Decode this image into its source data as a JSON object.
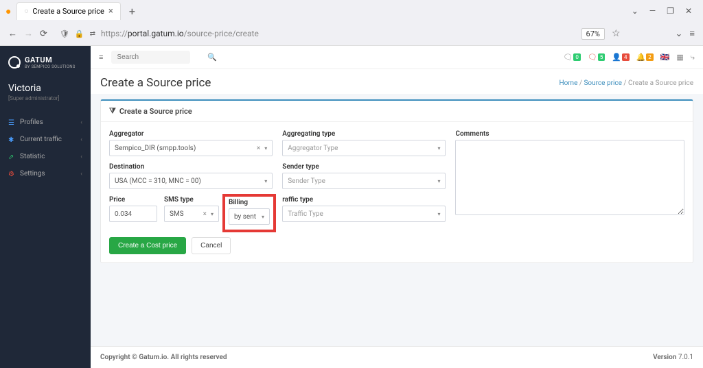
{
  "browser": {
    "tab_title": "Create a Source price",
    "url_prefix": "https://",
    "url_host": "portal.gatum.io",
    "url_path": "/source-price/create",
    "zoom": "67%"
  },
  "brand": {
    "name": "GATUM",
    "tagline": "BY SEMPICO SOLUTIONS"
  },
  "user": {
    "name": "Victoria",
    "role": "[Super administrator]"
  },
  "sidebar": {
    "items": [
      {
        "label": "Profiles"
      },
      {
        "label": "Current traffic"
      },
      {
        "label": "Statistic"
      },
      {
        "label": "Settings"
      }
    ]
  },
  "topbar": {
    "search_placeholder": "Search",
    "badges": [
      "0",
      "5",
      "4",
      "2"
    ]
  },
  "page": {
    "title": "Create a Source price",
    "breadcrumb": {
      "home": "Home",
      "parent": "Source price",
      "current": "Create a Source price"
    },
    "card_title": "Create a Source price"
  },
  "form": {
    "labels": {
      "aggregator": "Aggregator",
      "aggregating_type": "Aggregating type",
      "comments": "Comments",
      "destination": "Destination",
      "sender_type": "Sender type",
      "price": "Price",
      "sms_type": "SMS type",
      "billing": "Billing",
      "traffic_type": "raffic type"
    },
    "values": {
      "aggregator": "Sempico_DIR (smpp.tools)",
      "aggregating_type": "Aggregator Type",
      "destination": "USA (MCC = 310, MNC = 00)",
      "sender_type": "Sender Type",
      "price": "0.034",
      "sms_type": "SMS",
      "billing": "by sent",
      "traffic_type": "Traffic Type"
    },
    "buttons": {
      "submit": "Create a Cost price",
      "cancel": "Cancel"
    }
  },
  "footer": {
    "copyright": "Copyright © Gatum.io. All rights reserved",
    "version_label": "Version",
    "version": "7.0.1"
  }
}
